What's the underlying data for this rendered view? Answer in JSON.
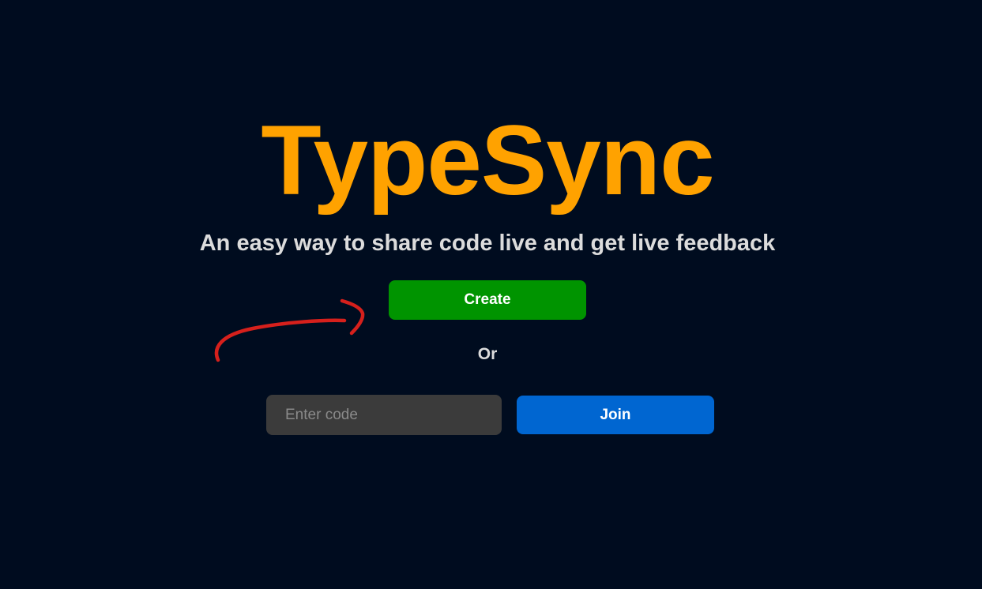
{
  "app": {
    "title": "TypeSync",
    "tagline": "An easy way to share code live and get live feedback"
  },
  "actions": {
    "create_label": "Create",
    "or_label": "Or",
    "code_input": {
      "placeholder": "Enter code",
      "value": ""
    },
    "join_label": "Join"
  },
  "colors": {
    "background": "#000c1f",
    "title": "#ffa200",
    "tagline": "#dcdcdc",
    "create_button": "#009400",
    "join_button": "#0066d1",
    "input_background": "#3b3b3b",
    "input_text": "#dcdcdc",
    "annotation_arrow": "#d6201c"
  },
  "annotation": {
    "icon": "hand-drawn-arrow-icon"
  }
}
